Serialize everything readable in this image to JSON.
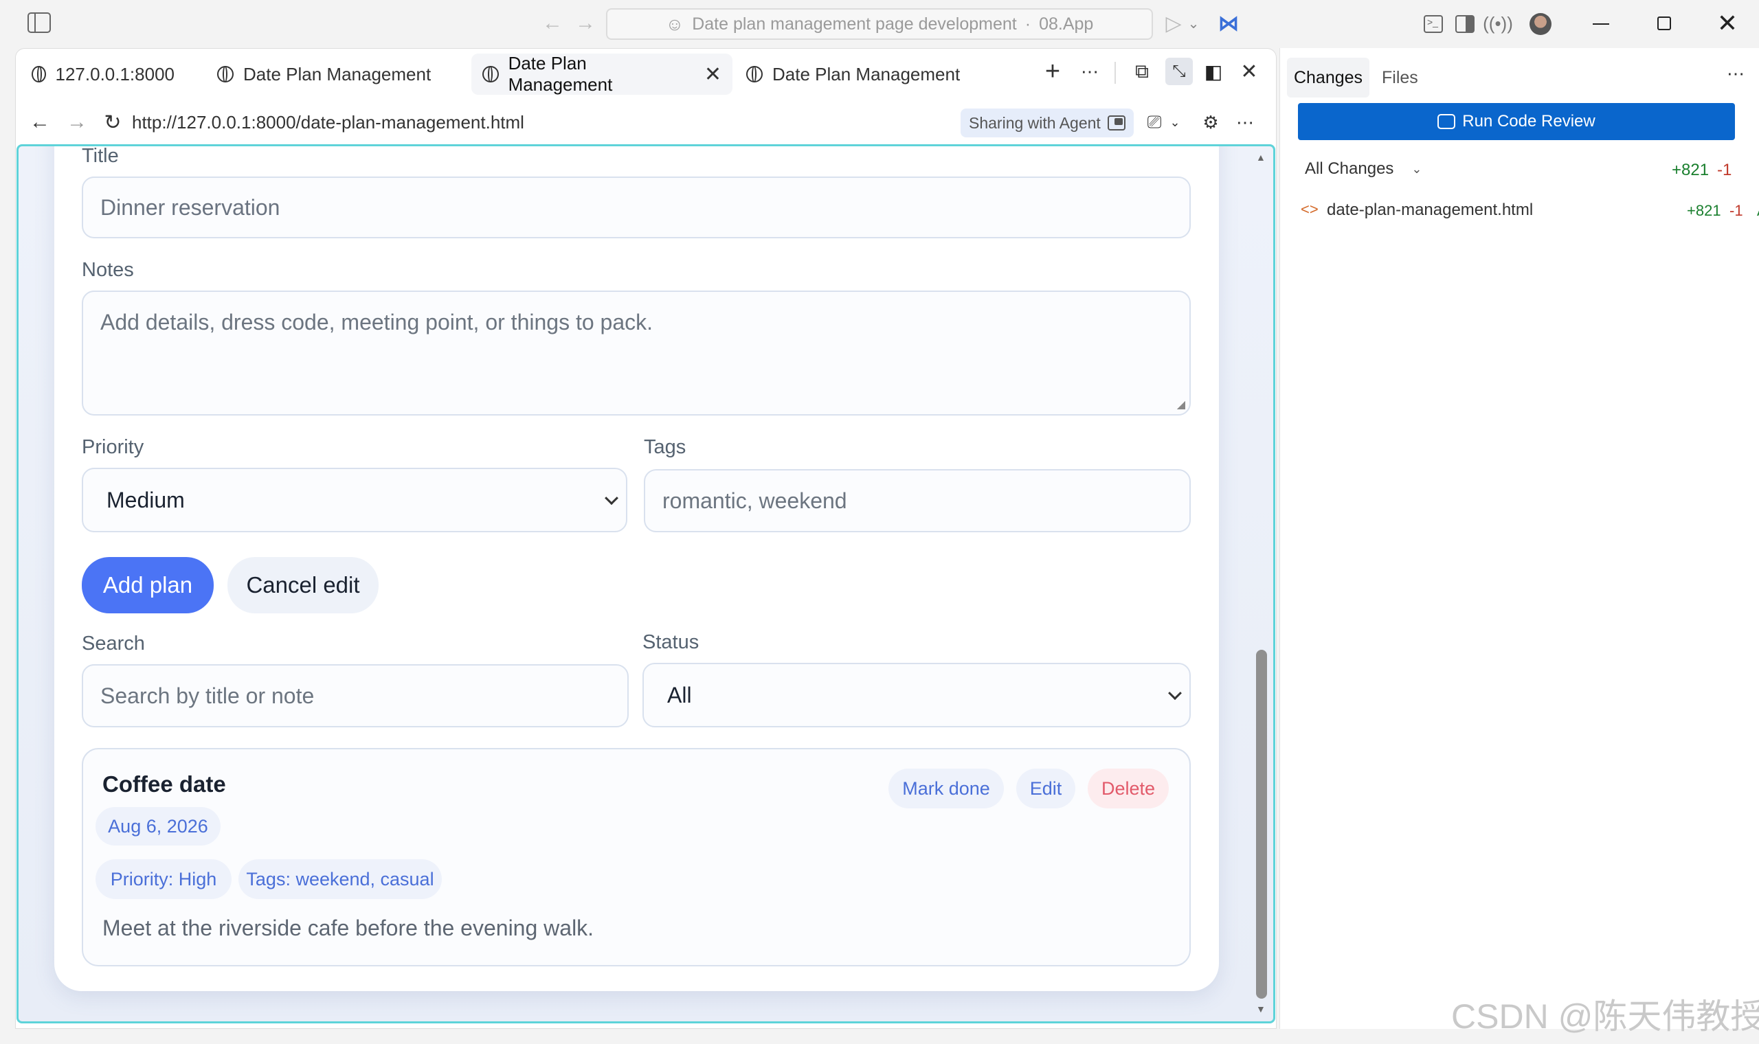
{
  "window": {
    "title": "Date plan management page development",
    "app": "08.App",
    "separator": "·"
  },
  "tabs": [
    {
      "label": "127.0.0.1:8000"
    },
    {
      "label": "Date Plan Management"
    },
    {
      "label": "Date Plan Management"
    },
    {
      "label": "Date Plan Management"
    }
  ],
  "address": {
    "url": "http://127.0.0.1:8000/date-plan-management.html",
    "sharing_label": "Sharing with Agent"
  },
  "form": {
    "title_label": "Title",
    "title_value": "Dinner reservation",
    "notes_label": "Notes",
    "notes_placeholder": "Add details, dress code, meeting point, or things to pack.",
    "priority_label": "Priority",
    "priority_value": "Medium",
    "tags_label": "Tags",
    "tags_value": "romantic, weekend",
    "add_button": "Add plan",
    "cancel_button": "Cancel edit"
  },
  "filters": {
    "search_label": "Search",
    "search_placeholder": "Search by title or note",
    "status_label": "Status",
    "status_value": "All"
  },
  "plan": {
    "title": "Coffee date",
    "date": "Aug 6, 2026",
    "priority": "Priority: High",
    "tags": "Tags: weekend, casual",
    "note": "Meet at the riverside cafe before the evening walk.",
    "mark_done": "Mark done",
    "edit": "Edit",
    "delete": "Delete"
  },
  "side": {
    "tab_changes": "Changes",
    "tab_files": "Files",
    "run_review": "Run Code Review",
    "all_changes": "All Changes",
    "added_total": "+821",
    "removed_total": "-1",
    "file_name": "date-plan-management.html",
    "file_added": "+821",
    "file_removed": "-1",
    "file_status": "A"
  },
  "watermark": "CSDN @陈天伟教授",
  "colors": {
    "primary": "#4b74f5",
    "review_button": "#0a66cc",
    "danger": "#e25a6a",
    "added": "#1a7f2e",
    "removed": "#c0392b",
    "viewport_border": "#5ed3d9"
  }
}
